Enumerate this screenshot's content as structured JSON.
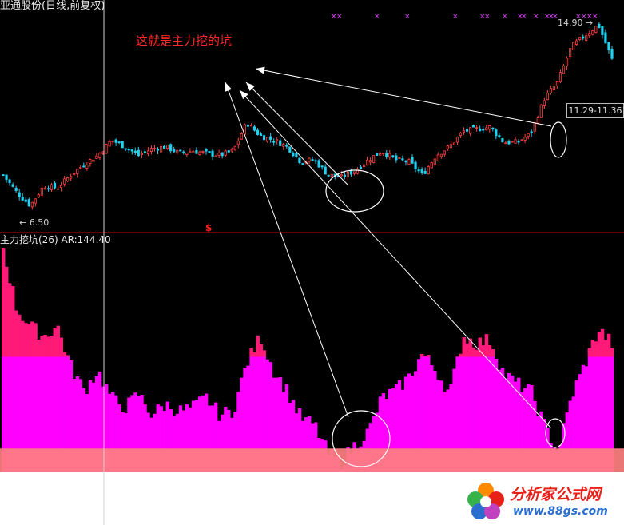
{
  "window": {
    "title": "亚通股份(日线,前复权)"
  },
  "annotations": {
    "main_note": "这就是主力挖的坑",
    "low_label": "← 6.50",
    "high_label": "14.90",
    "high_arrow": "→",
    "range_box": "11.29-11.36",
    "dollar_marker": "$"
  },
  "indicator": {
    "title": "主力挖坑(26)  AR:144.40"
  },
  "logo": {
    "name": "分析家公式网",
    "url": "www.88gs.com"
  },
  "colors": {
    "background": "#000000",
    "up_candle": "#ff4040",
    "down_candle": "#20d0f0",
    "indicator_fill": "#ff00ff",
    "indicator_upper": "#ff1a75",
    "indicator_base": "#ff8080",
    "annotation_red": "#ff2a2a",
    "panel_divider": "#c00000"
  },
  "chart_data": [
    {
      "type": "candlestick",
      "title": "亚通股份(日线,前复权)",
      "low_marked": 6.5,
      "high_marked": 14.9,
      "highlighted_range": [
        11.29,
        11.36
      ],
      "close_path": [
        8.0,
        7.2,
        6.6,
        7.5,
        7.4,
        8.0,
        8.5,
        8.9,
        9.6,
        9.3,
        8.9,
        9.2,
        9.3,
        9.0,
        9.1,
        9.0,
        8.9,
        9.1,
        10.4,
        9.8,
        9.6,
        9.3,
        8.6,
        8.7,
        8.0,
        7.9,
        8.2,
        8.7,
        9.1,
        8.7,
        8.6,
        8.0,
        8.9,
        9.3,
        10.0,
        10.1,
        10.2,
        9.5,
        9.5,
        9.9,
        11.5,
        12.3,
        13.9,
        14.4,
        14.9,
        13.3
      ]
    },
    {
      "type": "area",
      "title": "主力挖坑(26)",
      "value_label": "AR:144.40",
      "ar": 144.4,
      "values": [
        330,
        240,
        215,
        200,
        215,
        155,
        120,
        150,
        110,
        95,
        115,
        85,
        100,
        90,
        95,
        110,
        85,
        90,
        160,
        200,
        150,
        120,
        80,
        70,
        28,
        15,
        40,
        60,
        110,
        120,
        140,
        175,
        150,
        115,
        200,
        190,
        195,
        145,
        130,
        120,
        70,
        30,
        110,
        160,
        210,
        190
      ],
      "bands": {
        "upper_above": 170,
        "base_below": 35
      }
    }
  ]
}
